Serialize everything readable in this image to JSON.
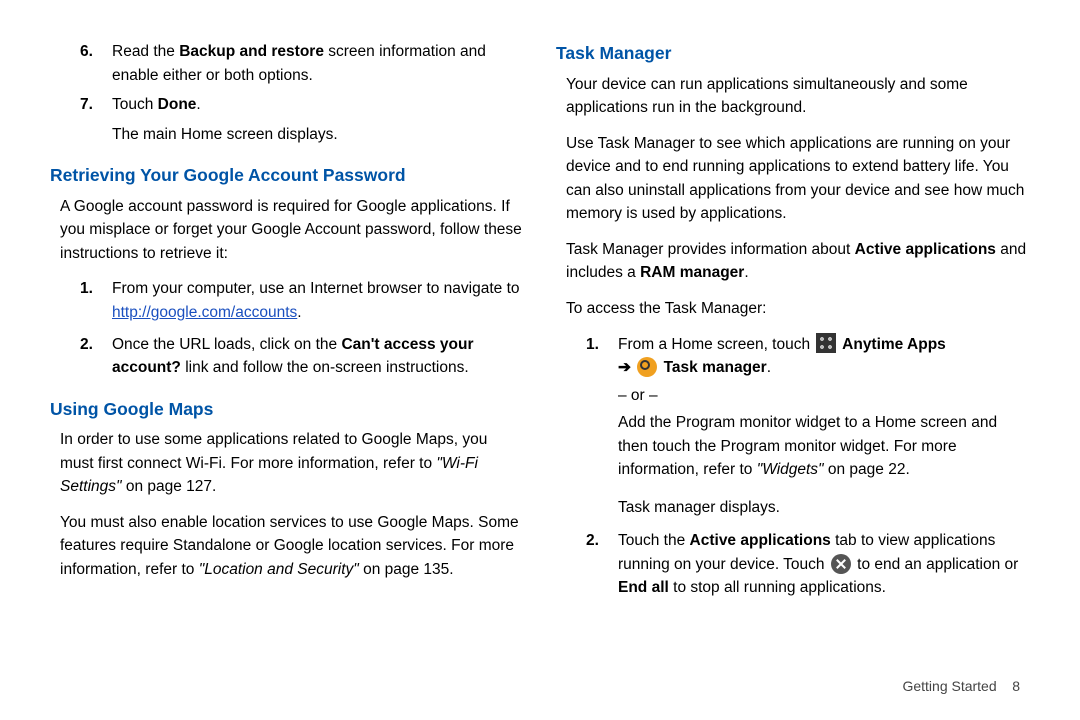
{
  "left": {
    "items67": [
      {
        "num": "6.",
        "textA": "Read the ",
        "bold1": "Backup and restore",
        "textB": " screen information and enable either or both options."
      },
      {
        "num": "7.",
        "textA": "Touch ",
        "bold1": "Done",
        "textB": ".",
        "after": "The main Home screen displays."
      }
    ],
    "retrieve": {
      "title": "Retrieving Your Google Account Password",
      "intro": "A Google account password is required for Google applications. If you misplace or forget your Google Account password, follow these instructions to retrieve it:",
      "s1_pre": "From your computer, use an Internet browser to navigate to ",
      "s1_link": "http://google.com/accounts",
      "s1_post": ".",
      "s2_pre": "Once the URL loads, click on the ",
      "s2_bold": "Can't access your account?",
      "s2_post": " link and follow the on-screen instructions.",
      "n1": "1.",
      "n2": "2."
    },
    "maps": {
      "title": "Using Google Maps",
      "p1a": "In order to use some applications related to Google Maps, you must first connect Wi-Fi. For more information, refer to ",
      "p1ref": "\"Wi-Fi Settings\"",
      "p1b": "  on page 127.",
      "p2a": "You must also enable location services to use Google Maps. Some features require Standalone or Google location services. For more information, refer to ",
      "p2ref": "\"Location and Security\"",
      "p2b": "  on page 135."
    }
  },
  "right": {
    "tm": {
      "title": "Task Manager",
      "p1": "Your device can run applications simultaneously and some applications run in the background.",
      "p2": "Use Task Manager to see which applications are running on your device and to end running applications to extend battery life. You can also uninstall applications from your device and see how much memory is used by applications.",
      "p3a": "Task Manager provides information about ",
      "p3b1": "Active applications",
      "p3b": " and includes a ",
      "p3b2": "RAM manager",
      "p3c": ".",
      "lead": "To access the Task Manager:",
      "n1": "1.",
      "s1_a": "From a Home screen, touch ",
      "s1_apps": " Anytime Apps",
      "s1_arrow": " ➔ ",
      "s1_tm": " Task manager",
      "s1_end": ".",
      "or": "– or –",
      "s1_alt_a": "Add the Program monitor widget to a Home screen and then touch the Program monitor widget. For more information, refer to ",
      "s1_alt_ref": "\"Widgets\"",
      "s1_alt_b": "  on page 22.",
      "s1_res": "Task manager displays.",
      "n2": "2.",
      "s2_a": "Touch the ",
      "s2_b1": "Active applications",
      "s2_b": " tab to view applications running on your device. Touch ",
      "s2_c": " to end an application or ",
      "s2_b2": "End all",
      "s2_d": " to stop all running applications."
    }
  },
  "footer": {
    "section": "Getting Started",
    "page": "8"
  }
}
